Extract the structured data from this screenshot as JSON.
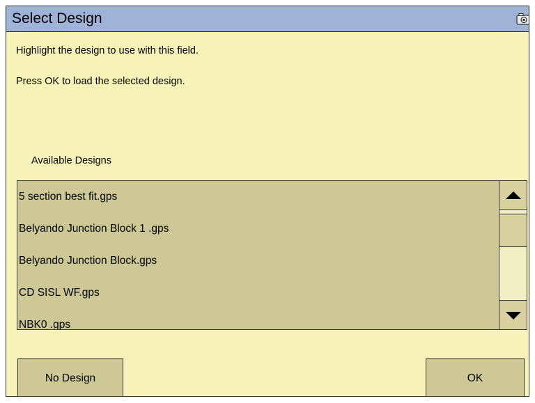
{
  "window": {
    "title": "Select Design",
    "icons": {
      "screenshot": "camera-icon"
    },
    "colors": {
      "titlebar": "#9fb3d6",
      "background": "#f7f3b8",
      "list_background": "#cdc896",
      "button_background": "#cdc896"
    }
  },
  "instructions": {
    "line1": "Highlight the design to use with this field.",
    "line2": "Press OK to load the selected design."
  },
  "designs": {
    "label": "Available Designs",
    "items": [
      "5 section best fit.gps",
      "Belyando Junction Block 1 .gps",
      "Belyando Junction Block.gps",
      "CD SISL WF.gps",
      "NBK0 .gps"
    ]
  },
  "buttons": {
    "no_design": "No Design",
    "ok": "OK"
  }
}
